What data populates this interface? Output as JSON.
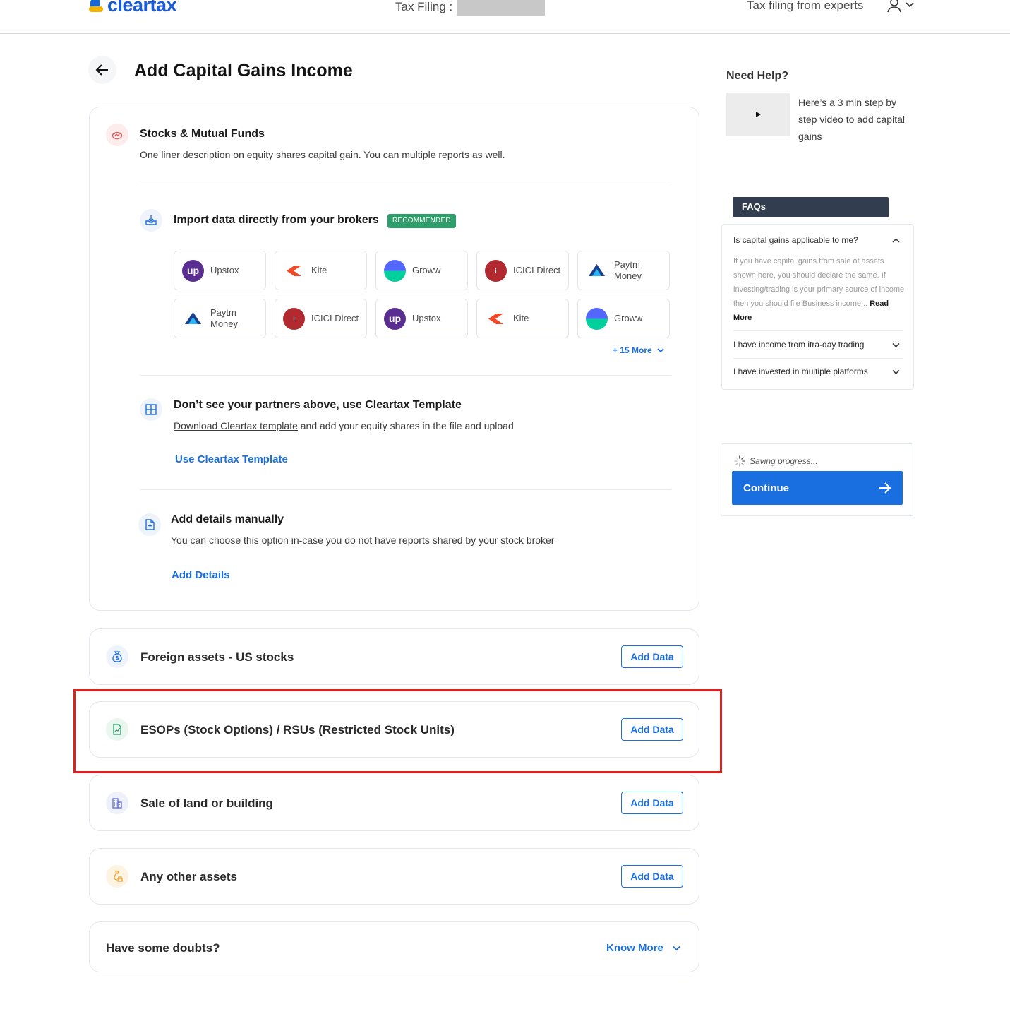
{
  "header": {
    "logo_text": "cleartax",
    "tax_filing_label": "Tax Filing :",
    "experts_link": "Tax filing from experts"
  },
  "page": {
    "title": "Add Capital Gains Income"
  },
  "stocks": {
    "title": "Stocks & Mutual Funds",
    "description": "One liner description on equity shares capital gain. You can multiple reports as well.",
    "import": {
      "title": "Import data directly from your brokers",
      "badge": "RECOMMENDED",
      "brokers": [
        {
          "name": "Upstox",
          "logo": "upstox-logo"
        },
        {
          "name": "Kite",
          "logo": "kite-logo"
        },
        {
          "name": "Groww",
          "logo": "groww-logo"
        },
        {
          "name": "ICICI Direct",
          "logo": "icici-logo"
        },
        {
          "name": "Paytm Money",
          "logo": "paytm-logo"
        },
        {
          "name": "Paytm Money",
          "logo": "paytm-logo"
        },
        {
          "name": "ICICI Direct",
          "logo": "icici-logo"
        },
        {
          "name": "Upstox",
          "logo": "upstox-logo"
        },
        {
          "name": "Kite",
          "logo": "kite-logo"
        },
        {
          "name": "Groww",
          "logo": "groww-logo"
        }
      ],
      "more_label": "+ 15 More"
    },
    "template": {
      "title": "Don’t see your partners above, use Cleartax Template",
      "download_link": "Download Cleartax template",
      "desc_rest": " and add your equity shares in the file and upload",
      "action": "Use Cleartax Template"
    },
    "manual": {
      "title": "Add details manually",
      "description": "You can choose this option in-case you do not have reports shared by your stock broker",
      "action": "Add Details"
    }
  },
  "assets": [
    {
      "title": "Foreign assets - US stocks",
      "button": "Add Data",
      "icon": "money-bag-icon"
    },
    {
      "title": "ESOPs (Stock Options) / RSUs (Restricted Stock Units)",
      "button": "Add Data",
      "icon": "stock-document-icon"
    },
    {
      "title": "Sale of land or building",
      "button": "Add Data",
      "icon": "building-icon"
    },
    {
      "title": "Any other assets",
      "button": "Add Data",
      "icon": "assets-icon"
    }
  ],
  "doubts": {
    "title": "Have some doubts?",
    "link": "Know More"
  },
  "help": {
    "title": "Need Help?",
    "video_text": "Here’s a 3 min step by step video to add capital gains"
  },
  "faqs": {
    "header": "FAQs",
    "items": [
      {
        "question": "Is capital gains applicable to me?",
        "answer": "If you have capital gains from sale of assets shown here, you should declare the same. If investing/trading is your primary source of income then you should file Business income... ",
        "read_more": "Read More"
      },
      {
        "question": "I have income from itra-day trading"
      },
      {
        "question": "I have invested in multiple platforms"
      }
    ]
  },
  "save": {
    "status": "Saving progress...",
    "continue_label": "Continue"
  },
  "colors": {
    "accent": "#1a6fe0",
    "badge": "#2e9e6b",
    "faq_header": "#323e50",
    "highlight": "#dd2020"
  }
}
